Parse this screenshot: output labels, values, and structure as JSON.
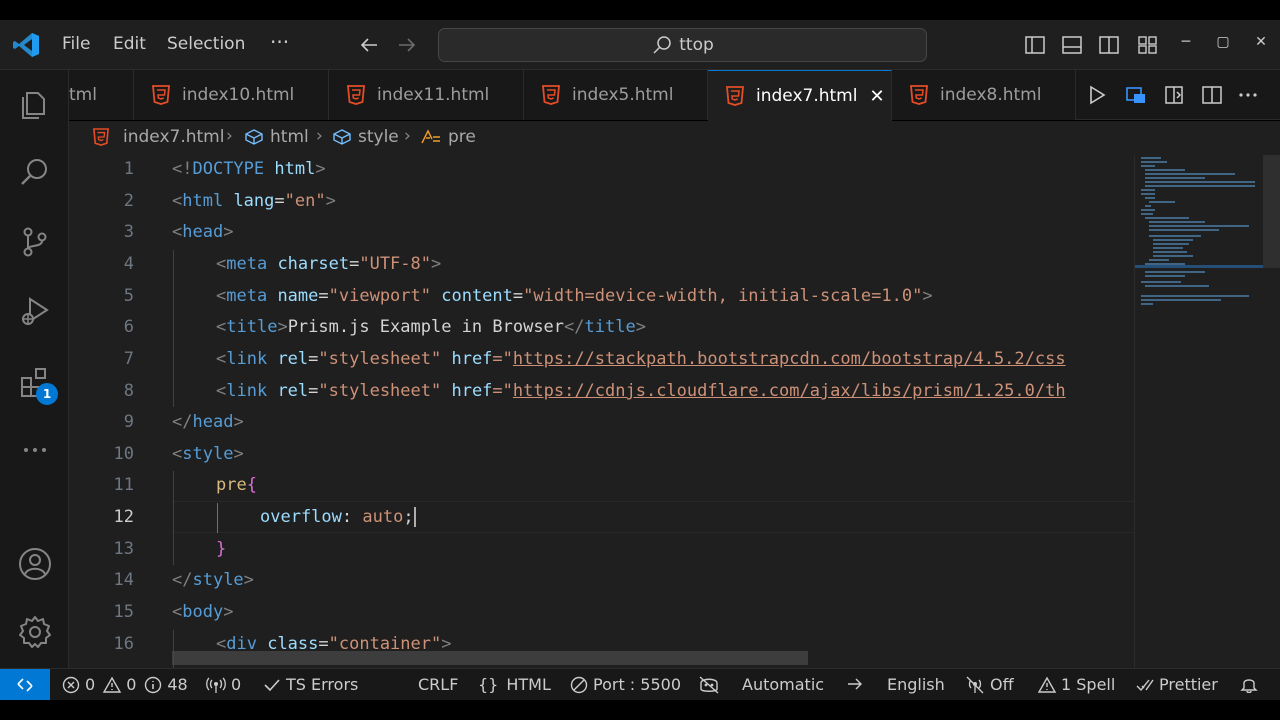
{
  "menu": {
    "file": "File",
    "edit": "Edit",
    "selection": "Selection",
    "more": "···"
  },
  "search": {
    "text": "ttop"
  },
  "window": {
    "minimize": "─",
    "maximize": "▢",
    "close": "✕"
  },
  "activity": {
    "extensions_badge": "1"
  },
  "tabs": [
    {
      "label": "tml",
      "active": false
    },
    {
      "label": "index10.html",
      "active": false
    },
    {
      "label": "index11.html",
      "active": false
    },
    {
      "label": "index5.html",
      "active": false
    },
    {
      "label": "index7.html",
      "active": true
    },
    {
      "label": "index8.html",
      "active": false
    }
  ],
  "breadcrumb": {
    "file": "index7.html",
    "html": "html",
    "style": "style",
    "pre": "pre"
  },
  "editor": {
    "line_numbers": [
      "1",
      "2",
      "3",
      "4",
      "5",
      "6",
      "7",
      "8",
      "9",
      "10",
      "11",
      "12",
      "13",
      "14",
      "15",
      "16"
    ],
    "current_line": "12",
    "lines": {
      "l1": {
        "open": "<!",
        "doctype": "DOCTYPE",
        "html": " html",
        "close": ">"
      },
      "l2": {
        "open": "<",
        "tag": "html",
        "attr": " lang",
        "eq": "=",
        "val": "\"en\"",
        "close": ">"
      },
      "l3": {
        "open": "<",
        "tag": "head",
        "close": ">"
      },
      "l4": {
        "open": "<",
        "tag": "meta",
        "attr": " charset",
        "eq": "=",
        "val": "\"UTF-8\"",
        "close": ">"
      },
      "l5": {
        "open": "<",
        "tag": "meta",
        "attr1": " name",
        "eq1": "=",
        "val1": "\"viewport\"",
        "attr2": " content",
        "eq2": "=",
        "val2": "\"width=device-width, initial-scale=1.0\"",
        "close": ">"
      },
      "l6": {
        "open": "<",
        "tag": "title",
        "close": ">",
        "text": "Prism.js Example in Browser",
        "eopen": "</",
        "etag": "title",
        "eclose": ">"
      },
      "l7": {
        "open": "<",
        "tag": "link",
        "attr1": " rel",
        "eq1": "=",
        "val1": "\"stylesheet\"",
        "attr2": " href",
        "eq2": "=\"",
        "url": "https://stackpath.bootstrapcdn.com/bootstrap/4.5.2/css"
      },
      "l8": {
        "open": "<",
        "tag": "link",
        "attr1": " rel",
        "eq1": "=",
        "val1": "\"stylesheet\"",
        "attr2": " href",
        "eq2": "=\"",
        "url": "https://cdnjs.cloudflare.com/ajax/libs/prism/1.25.0/th"
      },
      "l9": {
        "open": "</",
        "tag": "head",
        "close": ">"
      },
      "l10": {
        "open": "<",
        "tag": "style",
        "close": ">"
      },
      "l11": {
        "sel": "pre",
        "brace": "{"
      },
      "l12": {
        "prop": "overflow",
        "colon": ": ",
        "val": "auto",
        "semi": ";"
      },
      "l13": {
        "brace": "}"
      },
      "l14": {
        "open": "</",
        "tag": "style",
        "close": ">"
      },
      "l15": {
        "open": "<",
        "tag": "body",
        "close": ">"
      },
      "l16": {
        "open": "<",
        "tag": "div",
        "attr": " class",
        "eq": "=",
        "val": "\"container\"",
        "close": ">"
      }
    }
  },
  "status": {
    "errors": "0",
    "warnings": "0",
    "info": "48",
    "ports": "0",
    "ts_errors": "TS Errors",
    "eol": "CRLF",
    "language": "HTML",
    "port": "Port : 5500",
    "automatic": "Automatic",
    "locale": "English",
    "off": "Off",
    "spell": "1 Spell",
    "prettier": "Prettier"
  },
  "colors": {
    "accent": "#0078d4",
    "html_icon": "#e44d26",
    "tag": "#569cd6",
    "attr": "#9cdcfe",
    "string": "#ce9178",
    "selector": "#d7ba7d"
  },
  "icons": {
    "activity": [
      "explorer-icon",
      "search-icon",
      "source-control-icon",
      "run-debug-icon",
      "extensions-icon",
      "more-icon",
      "account-icon",
      "settings-gear-icon"
    ],
    "editor_actions": [
      "run-icon",
      "live-preview-icon",
      "open-changes-icon",
      "split-editor-icon",
      "more-actions-icon"
    ]
  }
}
